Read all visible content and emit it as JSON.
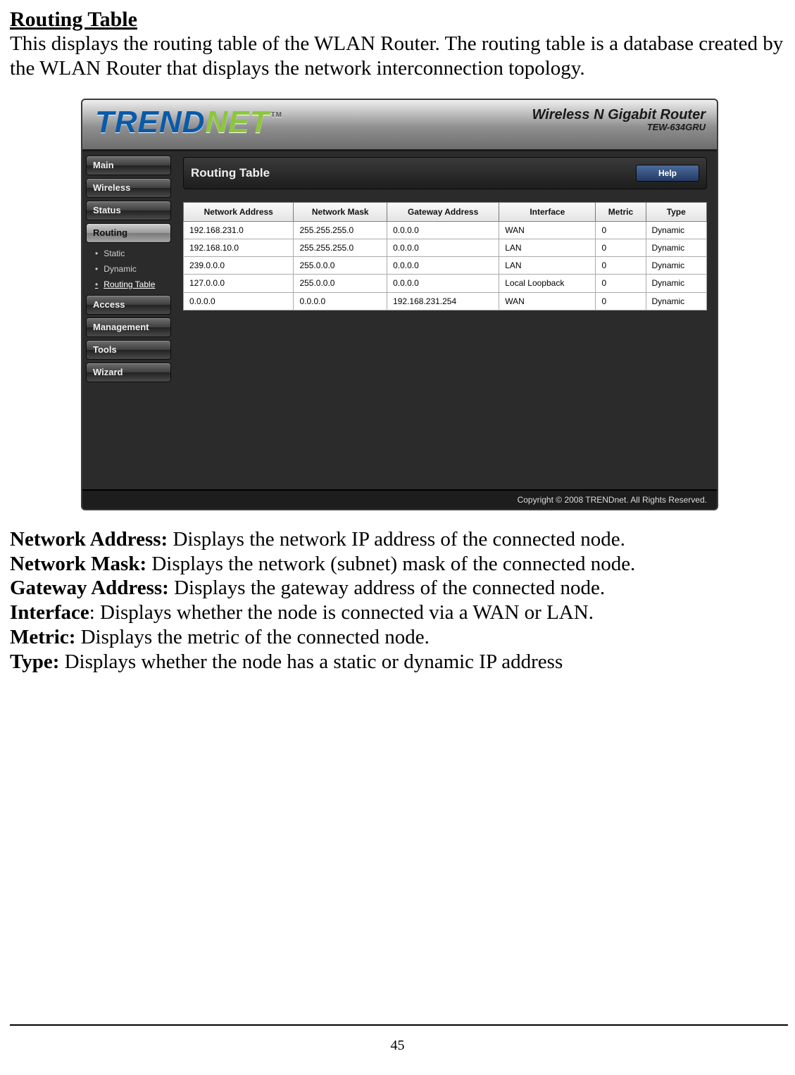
{
  "doc": {
    "section_title": "Routing Table",
    "intro": "This displays the routing table of the WLAN Router. The routing table is a database created by the WLAN Router that displays the network interconnection topology.",
    "definitions": [
      {
        "term": "Network Address:",
        "desc": " Displays the network IP address of the connected node."
      },
      {
        "term": "Network Mask:",
        "desc": " Displays the network (subnet) mask of the connected node."
      },
      {
        "term": "Gateway Address:",
        "desc": " Displays the gateway address of the connected node."
      },
      {
        "term": "Interface",
        "desc": ": Displays whether the node is connected via a WAN or LAN."
      },
      {
        "term": "Metric:",
        "desc": " Displays the metric of the connected node."
      },
      {
        "term": "Type:",
        "desc": " Displays whether the node has a static or dynamic IP address"
      }
    ],
    "page_number": "45"
  },
  "router": {
    "brand_prefix": "TREND",
    "brand_suffix": "NET",
    "tm": "TM",
    "product_line": "Wireless N Gigabit Router",
    "model": "TEW-634GRU",
    "panel_title": "Routing Table",
    "help_label": "Help",
    "nav": {
      "items": [
        "Main",
        "Wireless",
        "Status",
        "Routing",
        "Access",
        "Management",
        "Tools",
        "Wizard"
      ],
      "selected": "Routing",
      "sub": {
        "parent": "Routing",
        "items": [
          "Static",
          "Dynamic",
          "Routing Table"
        ],
        "active": "Routing Table"
      }
    },
    "table": {
      "headers": [
        "Network Address",
        "Network Mask",
        "Gateway Address",
        "Interface",
        "Metric",
        "Type"
      ],
      "rows": [
        [
          "192.168.231.0",
          "255.255.255.0",
          "0.0.0.0",
          "WAN",
          "0",
          "Dynamic"
        ],
        [
          "192.168.10.0",
          "255.255.255.0",
          "0.0.0.0",
          "LAN",
          "0",
          "Dynamic"
        ],
        [
          "239.0.0.0",
          "255.0.0.0",
          "0.0.0.0",
          "LAN",
          "0",
          "Dynamic"
        ],
        [
          "127.0.0.0",
          "255.0.0.0",
          "0.0.0.0",
          "Local Loopback",
          "0",
          "Dynamic"
        ],
        [
          "0.0.0.0",
          "0.0.0.0",
          "192.168.231.254",
          "WAN",
          "0",
          "Dynamic"
        ]
      ]
    },
    "copyright": "Copyright © 2008 TRENDnet. All Rights Reserved."
  }
}
